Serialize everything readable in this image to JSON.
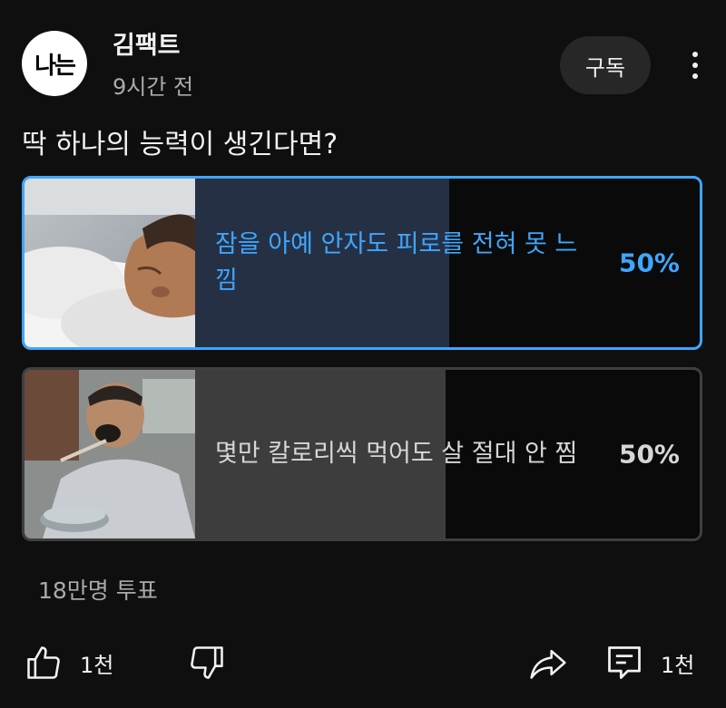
{
  "channel": {
    "avatar_text": "나는",
    "name": "김팩트",
    "time": "9시간 전",
    "subscribe_label": "구독"
  },
  "post": {
    "question": "딱 하나의 능력이 생긴다면?",
    "options": [
      {
        "label": "잠을 아예 안자도 피로를 전혀 못 느낌",
        "percent": "50%",
        "selected": true,
        "thumbnail_icon": "sleeping-man-photo"
      },
      {
        "label": "몇만 칼로리씩 먹어도 살 절대 안 찜",
        "percent": "50%",
        "selected": false,
        "thumbnail_icon": "eating-man-photo"
      }
    ],
    "vote_count": "18만명 투표"
  },
  "actions": {
    "like_count": "1천",
    "comment_count": "1천"
  },
  "colors": {
    "background": "#0f0f0f",
    "accent": "#3ea6ff",
    "subscribe_bg": "#272727",
    "selected_fill": "#263045",
    "unselected_fill": "#3d3d3d"
  }
}
